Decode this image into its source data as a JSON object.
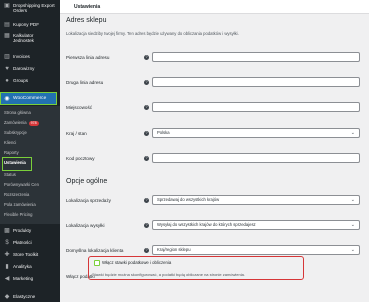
{
  "header": {
    "title": "Ustawienia"
  },
  "sidebar": {
    "items_top": [
      {
        "label": "Dropshipping Export Orders",
        "icon": "box-icon"
      },
      {
        "label": "Kupony PDF",
        "icon": "coupon-icon"
      },
      {
        "label": "Kalkulator Jednostek",
        "icon": "calculator-icon"
      },
      {
        "label": "Invoices",
        "icon": "invoice-icon"
      },
      {
        "label": "Darowizny",
        "icon": "heart-icon"
      },
      {
        "label": "Groups",
        "icon": "groups-icon"
      }
    ],
    "woocommerce": "WooCommerce",
    "submenu": [
      "Strona główna",
      "Zamówienia",
      "Subskrypcje",
      "Klienci",
      "Raporty",
      "Ustawienia",
      "Status",
      "Porównywarki Cen",
      "Rozszerzenia",
      "Pola zamówienia",
      "Flexible Pricing"
    ],
    "orders_badge": "978",
    "items_bottom": [
      {
        "label": "Produkty",
        "icon": "product-icon"
      },
      {
        "label": "Płatności",
        "icon": "payments-icon"
      },
      {
        "label": "Store Toolkit",
        "icon": "toolkit-icon"
      },
      {
        "label": "Analityka",
        "icon": "analytics-icon"
      },
      {
        "label": "Marketing",
        "icon": "megaphone-icon"
      },
      {
        "label": "Elastyczne",
        "icon": "flex-icon"
      }
    ]
  },
  "address": {
    "heading": "Adres sklepu",
    "description": "Lokalizacja siedziby twojej firmy. Ten adres będzie używany do obliczania podatków i wysyłki.",
    "fields": [
      {
        "label": "Pierwsza linia adresu",
        "value": ""
      },
      {
        "label": "Druga linia adresu",
        "value": ""
      },
      {
        "label": "Miejscowość",
        "value": ""
      },
      {
        "label": "Kraj / stan",
        "value": "Polska"
      },
      {
        "label": "Kod pocztowy",
        "value": ""
      }
    ]
  },
  "general": {
    "heading": "Opcje ogólne",
    "fields": [
      {
        "label": "Lokalizacja sprzedaży",
        "value": "Sprzedawaj do wszystkich krajów"
      },
      {
        "label": "Lokalizacja wysyłki",
        "value": "Wysyłaj do wszystkich krajów do których sprzedajesz"
      },
      {
        "label": "Domyślna lokalizacja klienta",
        "value": "Kraj/region sklepu"
      }
    ],
    "taxes": {
      "label": "Włącz podatki",
      "checkbox_label": "Włącz stawki podatkowe i obliczenia",
      "description": "Stawki będzie można skonfigurować, a podatki będą obliczane na stronie zamówienia."
    }
  }
}
